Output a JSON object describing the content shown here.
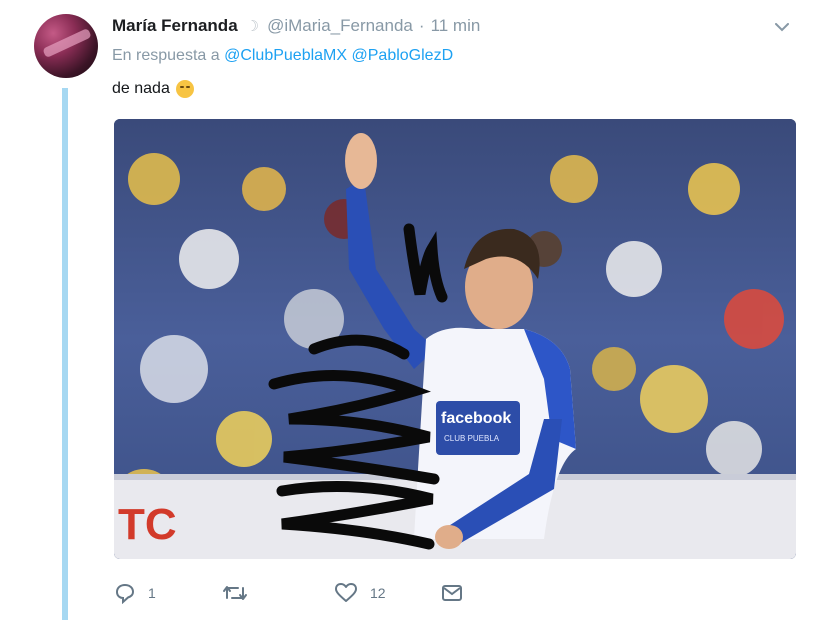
{
  "tweet": {
    "display_name": "María Fernanda",
    "handle": "@iMaria_Fernanda",
    "time": "11 min",
    "reply_prefix": "En respuesta a",
    "reply_to": [
      "@ClubPueblaMX",
      "@PabloGlezD"
    ],
    "text": "de nada",
    "emoji": "relieved-face",
    "media": {
      "jersey_sponsor": "facebook",
      "jersey_sub": "CLUB PUEBLA"
    },
    "actions": {
      "reply_count": "1",
      "retweet_count": "",
      "like_count": "12"
    }
  },
  "colors": {
    "link": "#1da1f2",
    "thread_line": "#a6d8f2",
    "muted": "#8899a6",
    "icon": "#657786"
  }
}
